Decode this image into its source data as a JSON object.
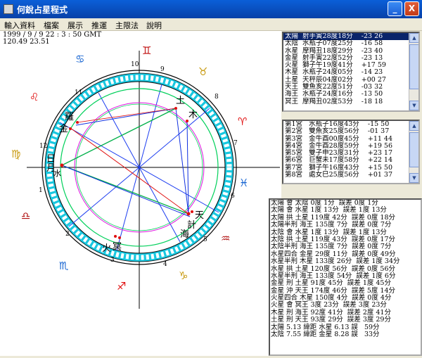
{
  "window": {
    "title": "何銳占星程式",
    "minimize": "_",
    "close": "X"
  },
  "menu": [
    "輸入資料",
    "檔案",
    "展示",
    "推運",
    "主限法",
    "說明"
  ],
  "info": {
    "datetime": "1999 / 9 / 9    22 : 3 : 50 GMT",
    "coords": "120.49   23.51"
  },
  "chart": {
    "zodiac_glyphs": [
      "♊",
      "♉",
      "♈",
      "♓",
      "♒",
      "♑",
      "♐",
      "♏",
      "♎",
      "♍",
      "♌",
      "♋"
    ],
    "house_numbers": [
      "1",
      "2",
      "3",
      "4",
      "5",
      "6",
      "7",
      "8",
      "9",
      "10",
      "11",
      "12"
    ],
    "planet_labels": {
      "sun": "日",
      "moon": "月",
      "mercury": "水",
      "venus": "金",
      "rahu": "羅",
      "saturn": "土",
      "jupiter": "木",
      "mars": "火",
      "ketu": "計",
      "uranus": "天",
      "neptune": "海",
      "pluto": "冥"
    }
  },
  "planets": [
    "太陽  射手寅28度18分    -23 26",
    "太陰  水瓶子07度25分    -16 58",
    "水星  摩羯丑18度29分    -23 40",
    "金星  射手寅22度52分    -23 13",
    "火星  獅子午19度41分    +17 59",
    "木星  水瓶子24度05分    -14 23",
    "土星  天秤辰04度02分    +00 27",
    "天王  雙魚亥22度51分    -03 32",
    "海王  水瓶子24度16分    -13 50",
    "冥王  摩羯丑02度53分    -18 18"
  ],
  "houses": [
    "第1宮   水瓶子16度43分    -15 50",
    "第2宮   雙魚亥25度56分    -01 37",
    "第3宮   金牛酉00度45分    +11 44",
    "第4宮   金牛酉28度59分    +19 56",
    "第5宮   雙子申23度31分    +23 17",
    "第6宮   巨蟹未17度58分    +22 14",
    "第7宮   獅子午16度43分    +15 50",
    "第8宮   處女巳25度56分    +01 37"
  ],
  "aspects": [
    "太陽 會 太陰 0度 1分  誤差 0度 1分",
    "太陽 會 水星 1度 13分  誤差 1度 13分",
    "太陽 拱 土星 119度 42分  誤差 0度 18分",
    "太陽半刑 海王 135度 7分  誤差 0度 7分",
    "太陰 會 水星 1度 13分  誤差 1度 13分",
    "太陰 拱 土星 119度 43分  誤差 0度 17分",
    "太陰半刑 海王 135度 7分  誤差 0度 7分",
    "水星四合 金星 29度 11分  誤差 0度 49分",
    "水星半刑 木星 133度 26分  誤差 1度 34分",
    "水星 拱 土星 120度 56分  誤差 0度 56分",
    "水星半刑 海王 133度 54分  誤差 1度 6分",
    "金星 刑 土星 91度 45分  誤差 1度 45分",
    "金星 沖 天王 174度 46分  誤差 5度 14分",
    "火星四合 木星 150度 4分  誤差 0度 4分",
    "火星 會 冥王 3度 23分  誤差 3度 23分",
    "木星 刑 海王 92度 41分  誤差 2度 41分",
    "土星 刑 天王 93度 29分  誤差 3度 29分",
    "太陽 5.13 緯距 水星 6.13 誤   59分",
    "太陰 7.55 緯距 金星 8.28 誤   33分"
  ]
}
